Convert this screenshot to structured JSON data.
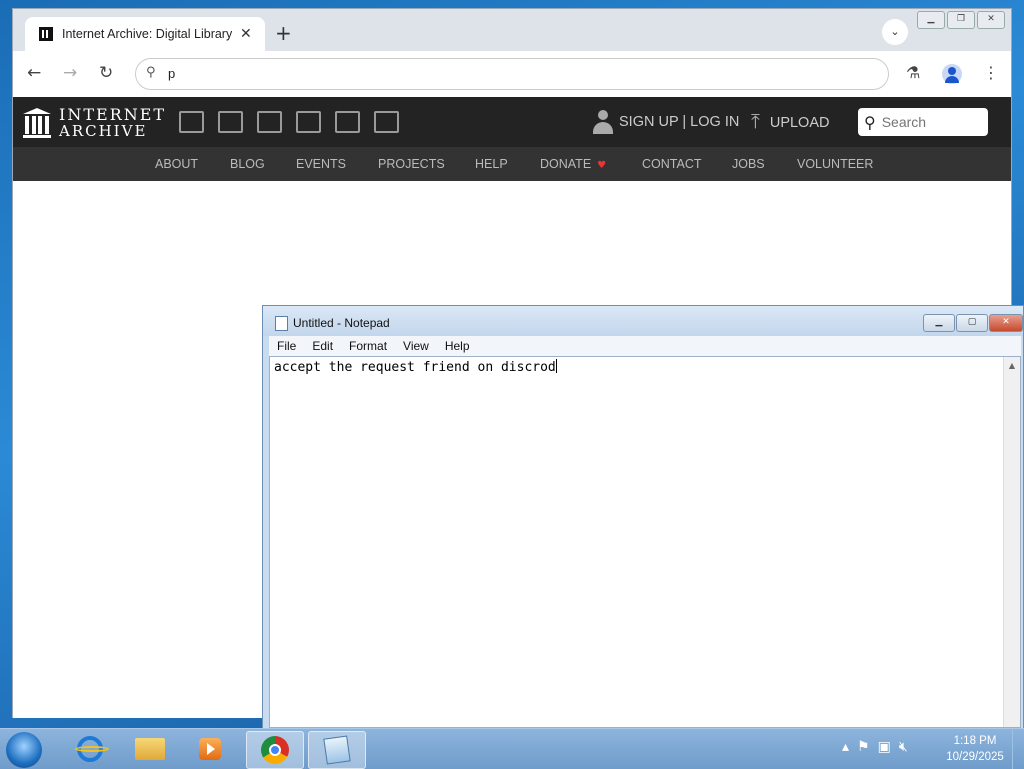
{
  "browser": {
    "tab_title": "Internet Archive: Digital Library",
    "address_value": "p",
    "tab_close": "✕",
    "new_tab": "+",
    "tab_search": "⌄"
  },
  "site": {
    "logo_line1": "INTERNET",
    "logo_line2": "ARCHIVE",
    "media_icons": [
      "web-icon",
      "texts-icon",
      "video-icon",
      "audio-icon",
      "software-icon",
      "images-icon"
    ],
    "signup_login": "SIGN UP | LOG IN",
    "upload": "UPLOAD",
    "search_placeholder": "Search",
    "nav": [
      "ABOUT",
      "BLOG",
      "EVENTS",
      "PROJECTS",
      "HELP",
      "DONATE",
      "CONTACT",
      "JOBS",
      "VOLUNTEER"
    ]
  },
  "notepad": {
    "title": "Untitled - Notepad",
    "menu": [
      "File",
      "Edit",
      "Format",
      "View",
      "Help"
    ],
    "content": "accept the request friend on discrod"
  },
  "taskbar": {
    "time": "1:18 PM",
    "date": "10/29/2025",
    "pinned": [
      "internet-explorer",
      "windows-explorer",
      "windows-media-player",
      "google-chrome",
      "notepad"
    ]
  },
  "colors": {
    "ia_header": "#232323",
    "ia_nav": "#333333",
    "donate_heart": "#ee3333",
    "notepad_close": "#c64a2e"
  }
}
